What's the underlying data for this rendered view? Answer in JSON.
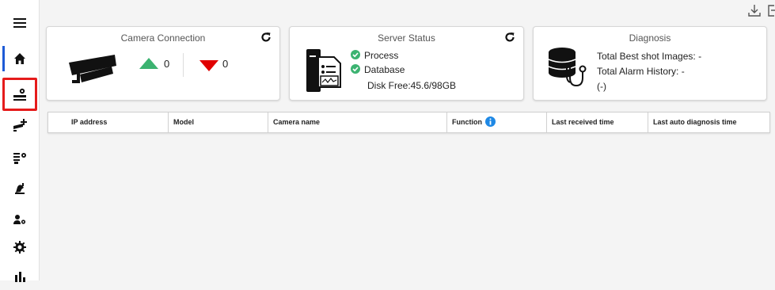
{
  "sidebar": {
    "items": [
      {
        "name": "menu-icon"
      },
      {
        "name": "home-icon"
      },
      {
        "name": "server-settings-icon"
      },
      {
        "name": "add-camera-icon"
      },
      {
        "name": "camera-settings-icon"
      },
      {
        "name": "alarm-icon"
      },
      {
        "name": "user-settings-icon"
      },
      {
        "name": "gear-icon"
      },
      {
        "name": "bar-chart-icon"
      }
    ]
  },
  "topbar": {
    "icons": [
      "download-icon",
      "export-icon"
    ]
  },
  "camera_connection": {
    "title": "Camera Connection",
    "online_count": "0",
    "offline_count": "0",
    "up_color": "#3cb371",
    "down_color": "#e00000"
  },
  "server_status": {
    "title": "Server Status",
    "process_label": "Process",
    "database_label": "Database",
    "disk_free": "Disk Free:45.6/98GB",
    "ok_color": "#3cb371"
  },
  "diagnosis": {
    "title": "Diagnosis",
    "best_shot": "Total Best shot Images: -",
    "alarm_history": "Total Alarm History: -",
    "note": "(-)"
  },
  "table": {
    "headers": [
      "IP address",
      "Model",
      "Camera name",
      "Function",
      "Last received time",
      "Last auto diagnosis time"
    ],
    "info_color": "#1e88e5"
  }
}
